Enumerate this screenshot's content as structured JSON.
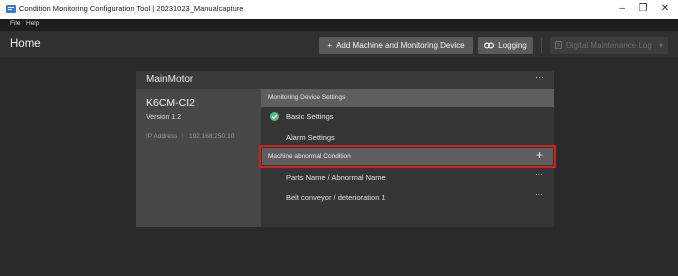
{
  "window": {
    "title": "Condition Monitoring Configuration Tool | 20231023_Manualcapture",
    "minimize": "–",
    "maximize": "❐",
    "close": "✕"
  },
  "menu": {
    "file": "File",
    "help": "Help"
  },
  "header": {
    "page_title": "Home",
    "add_button": "Add Machine and Monitoring Device",
    "add_icon": "+",
    "logging_button": "Logging",
    "logging_icon": "link-icon",
    "dml_button": "Digital Maintenance Log",
    "dml_icon": "log-icon",
    "dml_arrow": "▾"
  },
  "machine": {
    "name": "MainMotor",
    "more": "···",
    "device": {
      "model": "K6CM-CI2",
      "version": "Version 1.2",
      "ip_label": "IP Address",
      "ip_sep": "|",
      "ip_value": "192.168.250.10"
    },
    "monitoring_settings": {
      "header": "Monitoring Device Settings",
      "basic": "Basic Settings",
      "alarm": "Alarm Settings"
    },
    "abnormal": {
      "header": "Machine abnormal Condition",
      "add": "+",
      "column_header": "Parts Name / Abnormal Name",
      "column_more": "···",
      "rows": [
        {
          "name": "Belt conveyor / deterioration 1",
          "more": "···"
        }
      ]
    }
  },
  "colors": {
    "highlight": "#d42020",
    "check": "#4cbf8f"
  }
}
